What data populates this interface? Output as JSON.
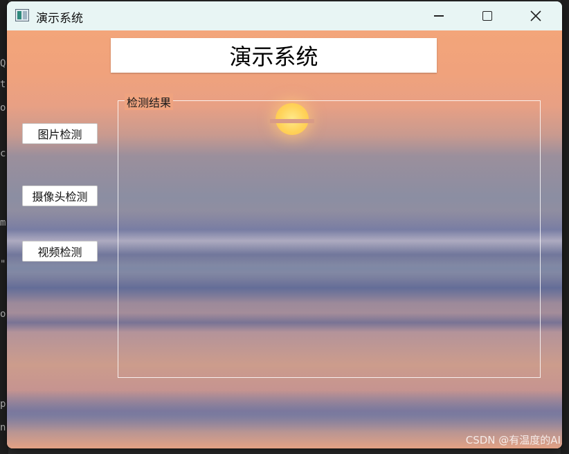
{
  "window": {
    "title": "演示系统",
    "icon": "app-window-icon",
    "controls": [
      "minimize-icon",
      "maximize-icon",
      "close-icon"
    ]
  },
  "header": {
    "title": "演示系统"
  },
  "sidebar": {
    "buttons": [
      {
        "label": "图片检测"
      },
      {
        "label": "摄像头检测"
      },
      {
        "label": "视频检测"
      }
    ]
  },
  "main": {
    "group_title": "检测结果"
  },
  "watermark": "CSDN @有温度的AI",
  "background_editor_fragments": [
    "Q",
    "t",
    "o",
    "c",
    "m",
    "\"",
    "o",
    "p",
    "n"
  ],
  "colors": {
    "titlebar_bg": "#e8f5f4",
    "header_box_bg": "#ffffff",
    "button_bg": "#ffffff",
    "group_border": "#ffffff"
  }
}
